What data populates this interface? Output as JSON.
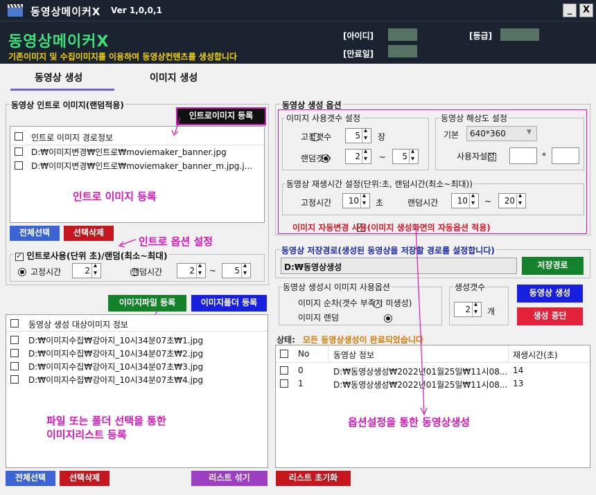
{
  "window": {
    "title": "동영상메이커X",
    "version": "Ver 1,0,0,1",
    "minimize": "_",
    "close": "X"
  },
  "header": {
    "brand": "동영상메이커X",
    "subtitle": "기존이미지 및 수집이미지를 이용하여 동영상컨텐츠를 생성합니다",
    "id_label": "[아이디]",
    "grade_label": "[등급]",
    "expire_label": "[만료일]"
  },
  "tabs": [
    {
      "label": "동영상 생성",
      "active": true
    },
    {
      "label": "이미지 생성",
      "active": false
    }
  ],
  "intro": {
    "group_title": "동영상 인트로 이미지(랜덤적용)",
    "register_button": "인트로이미지 등록",
    "list_header": "인트로 이미지 경로정보",
    "files": [
      "D:₩이미지변경₩인트로₩moviemaker_banner.jpg",
      "D:₩이미지변경₩인트로₩moviemaker_banner_m.jpg.j..."
    ],
    "annotation": "인트로 이미지 등록",
    "select_all": "전체선택",
    "delete_selected": "선택삭제",
    "option_annotation": "인트로 옵션 설정",
    "use_label": "인트로사용(단위 초)/랜덤(최소~최대)",
    "fixed_time": "고정시간",
    "fixed_value": "2",
    "random_time": "랜덤시간",
    "random_min": "2",
    "tilde": "~",
    "random_max": "5"
  },
  "images": {
    "file_register": "이미지파일 등록",
    "folder_register": "이미지폴더 등록",
    "list_header": "동영상 생성 대상이미지 정보",
    "files": [
      "D:₩이미지수집₩강아지_10시34분07초₩1.jpg",
      "D:₩이미지수집₩강아지_10시34분07초₩2.jpg",
      "D:₩이미지수집₩강아지_10시34분07초₩3.jpg",
      "D:₩이미지수집₩강아지_10시34분07초₩4.jpg"
    ],
    "annotation_line1": "파일 또는 폴더 선택을 통한",
    "annotation_line2": "이미지리스트 등록",
    "select_all": "전체선택",
    "delete_selected": "선택삭제",
    "shuffle": "리스트 섞기",
    "reset": "리스트 초기화"
  },
  "options": {
    "group_title": "동영상 생성 옵션",
    "count_title": "이미지 사용갯수 설정",
    "fixed_count": "고정갯수",
    "fixed_count_value": "5",
    "unit_jang": "장",
    "random_count": "랜덤갯수",
    "random_count_min": "2",
    "tilde": "~",
    "random_count_max": "5",
    "resolution_title": "동영상 해상도 설정",
    "basic_label": "기본",
    "resolution_value": "640*360",
    "custom_label": "사용자설정",
    "times": "*",
    "playtime_title": "동영상 재생시간 설정(단위:초, 랜덤시간(최소~최대))",
    "fixed_time": "고정시간",
    "fixed_time_value": "10",
    "unit_cho": "초",
    "random_time": "랜덤시간",
    "random_time_min": "10",
    "random_time_max": "20",
    "auto_change": "이미지 자동변경 사용(이미지 생성화면의 자동옵션 적용)"
  },
  "save": {
    "title": "동영상 저장경로(생성된 동영상을 저장할 경로를 설정합니다)",
    "path": "D:₩동영상생성",
    "button": "저장경로"
  },
  "image_usage": {
    "title": "동영상 생성시 이미지 사용옵션",
    "sequential": "이미지 순차(갯수 부족시 미생성)",
    "random": "이미지 랜덤"
  },
  "gen_count": {
    "title": "생성갯수",
    "value": "2",
    "unit": "개"
  },
  "actions": {
    "generate": "동영상 생성",
    "stop": "생성 중단"
  },
  "status": {
    "label": "상태:",
    "text": "모든 동영상생성이 완료되었습니다"
  },
  "result_table": {
    "headers": [
      "No",
      "동영상 정보",
      "재생시간(초)"
    ],
    "rows": [
      {
        "no": "0",
        "info": "D:₩동영상생성₩2022년01월25일₩11시08...",
        "time": "14"
      },
      {
        "no": "1",
        "info": "D:₩동영상생성₩2022년01월25일₩11시08...",
        "time": "13"
      }
    ],
    "annotation": "옵션설정을 통한 동영상생성"
  },
  "colors": {
    "titlebar": "#1b2330",
    "brand": "#3ee07a",
    "subtitle": "#f5d400",
    "annotation": "#d415b8",
    "tab_underline": "#6d63c9"
  }
}
